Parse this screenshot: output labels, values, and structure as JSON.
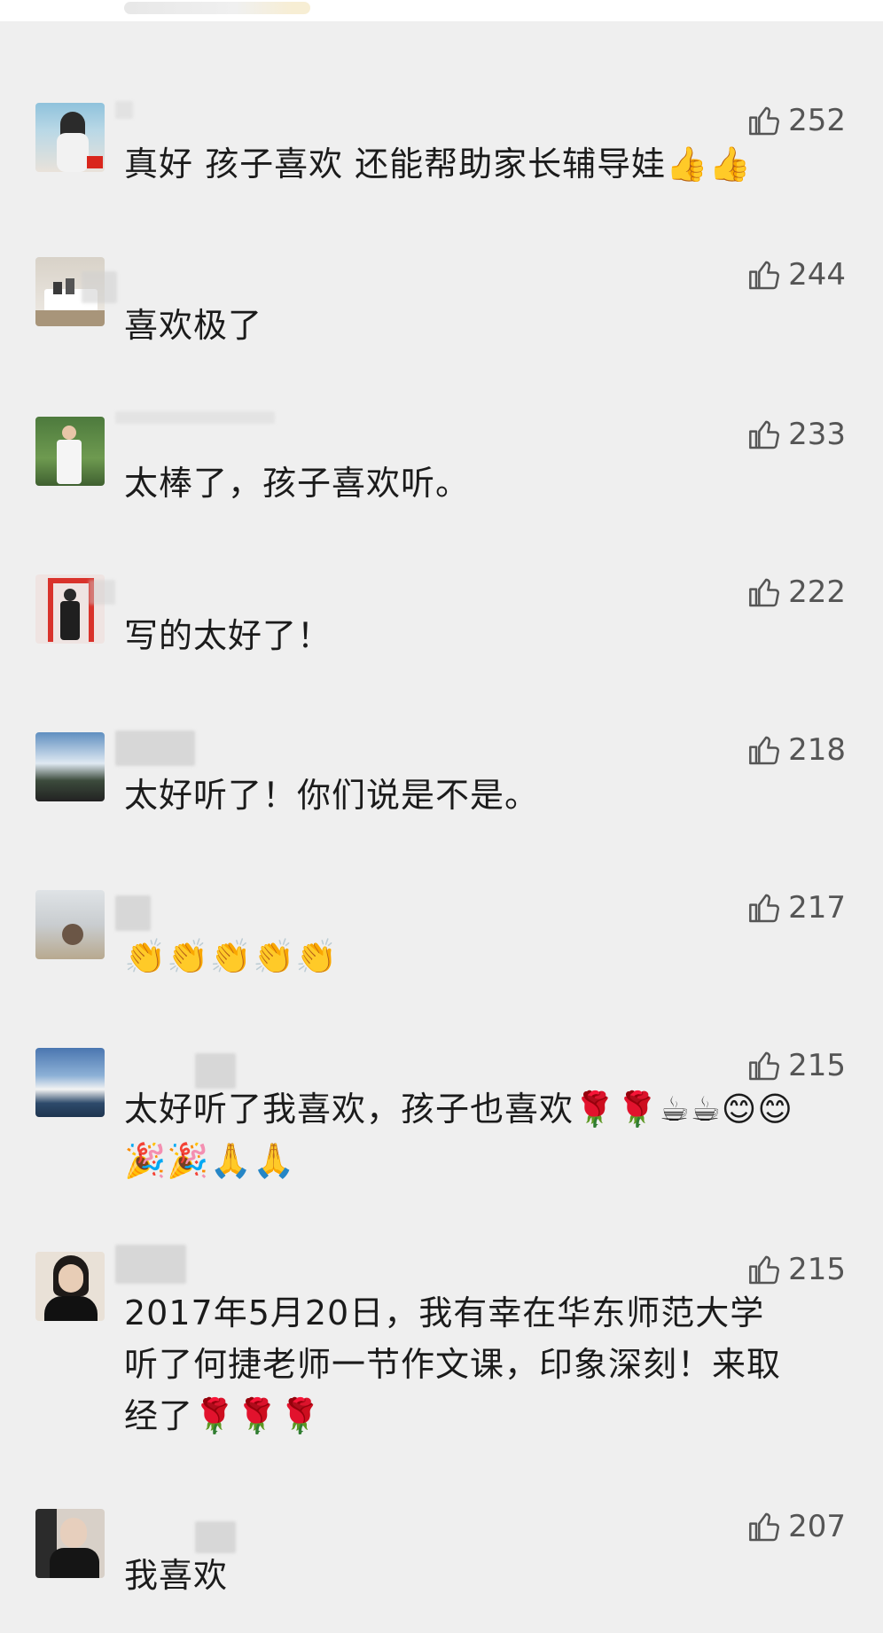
{
  "like_icon": "thumbs-up-icon",
  "comments": [
    {
      "likes": "252",
      "text": "真好 孩子喜欢 还能帮助家长辅导娃👍👍"
    },
    {
      "likes": "244",
      "text": "喜欢极了"
    },
    {
      "likes": "233",
      "text": "太棒了，孩子喜欢听。"
    },
    {
      "likes": "222",
      "text": "写的太好了！"
    },
    {
      "likes": "218",
      "text": "太好听了！你们说是不是。"
    },
    {
      "likes": "217",
      "text": "👏👏👏👏👏"
    },
    {
      "likes": "215",
      "text": "太好听了我喜欢，孩子也喜欢🌹🌹☕☕😊😊🎉🎉🙏🙏"
    },
    {
      "likes": "215",
      "text": "2017年5月20日，我有幸在华东师范大学听了何捷老师一节作文课，印象深刻！来取经了🌹🌹🌹"
    },
    {
      "likes": "207",
      "text": "我喜欢"
    }
  ]
}
